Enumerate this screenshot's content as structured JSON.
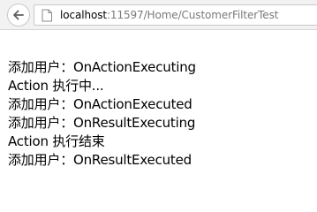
{
  "browser": {
    "back_icon": "back-arrow-icon",
    "page_icon": "page-icon",
    "url_host": "localhost",
    "url_rest": ":11597/Home/CustomerFilterTest"
  },
  "page": {
    "lines": [
      "添加用户：OnActionExecuting",
      "Action 执行中...",
      "添加用户：OnActionExecuted",
      "添加用户：OnResultExecuting",
      "Action 执行结束",
      "添加用户：OnResultExecuted"
    ]
  },
  "colors": {
    "toolbar_bg": "#f2f2f2",
    "url_host": "#000000",
    "url_path": "#7a7a7a",
    "text": "#000000"
  }
}
